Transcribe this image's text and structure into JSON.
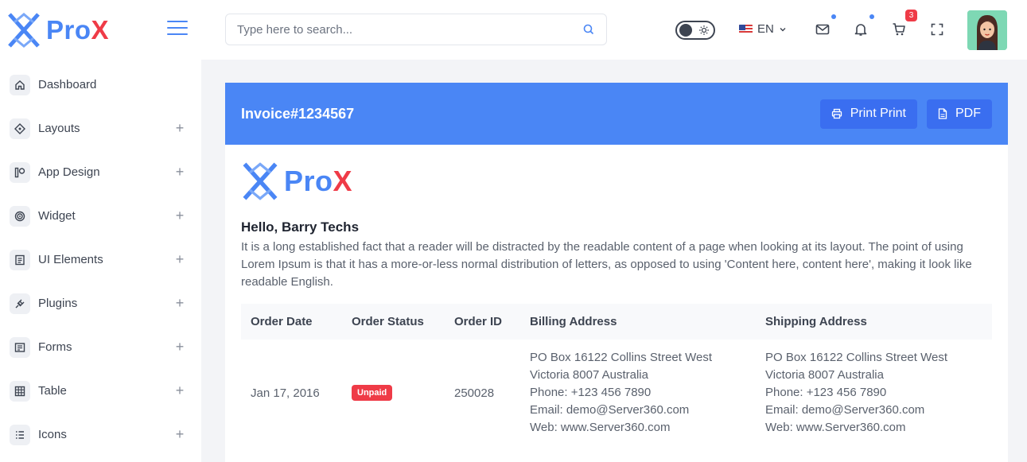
{
  "brand": {
    "part1": "Pro",
    "part2": "X"
  },
  "colors": {
    "primary": "#4a86f5",
    "danger": "#ef3b47",
    "button": "#3a6ef0"
  },
  "sidebar": {
    "items": [
      {
        "label": "Dashboard",
        "icon": "home-icon",
        "expandable": false
      },
      {
        "label": "Layouts",
        "icon": "diamond-icon",
        "expandable": true
      },
      {
        "label": "App Design",
        "icon": "app-design-icon",
        "expandable": true
      },
      {
        "label": "Widget",
        "icon": "target-icon",
        "expandable": true
      },
      {
        "label": "UI Elements",
        "icon": "ui-elements-icon",
        "expandable": true
      },
      {
        "label": "Plugins",
        "icon": "plug-icon",
        "expandable": true
      },
      {
        "label": "Forms",
        "icon": "form-icon",
        "expandable": true
      },
      {
        "label": "Table",
        "icon": "table-icon",
        "expandable": true
      },
      {
        "label": "Icons",
        "icon": "list-icon",
        "expandable": true
      }
    ],
    "expand_symbol": "+"
  },
  "header": {
    "search_placeholder": "Type here to search...",
    "language": "EN",
    "cart_count": "3"
  },
  "invoice": {
    "title": "Invoice#1234567",
    "print_label": "Print Print",
    "pdf_label": "PDF",
    "greeting": "Hello, Barry Techs",
    "paragraph": "It is a long established fact that a reader will be distracted by the readable content of a page when looking at its layout. The point of using Lorem Ipsum is that it has a more-or-less normal distribution of letters, as opposed to using 'Content here, content here', making it look like readable English.",
    "table": {
      "headers": [
        "Order Date",
        "Order Status",
        "Order ID",
        "Billing Address",
        "Shipping Address"
      ],
      "row": {
        "date": "Jan 17, 2016",
        "status": "Unpaid",
        "order_id": "250028",
        "billing": [
          "PO Box 16122 Collins Street West",
          "Victoria 8007 Australia",
          "Phone: +123 456 7890",
          "Email: demo@Server360.com",
          "Web: www.Server360.com"
        ],
        "shipping": [
          "PO Box 16122 Collins Street West",
          "Victoria 8007 Australia",
          "Phone: +123 456 7890",
          "Email: demo@Server360.com",
          "Web: www.Server360.com"
        ]
      }
    }
  }
}
